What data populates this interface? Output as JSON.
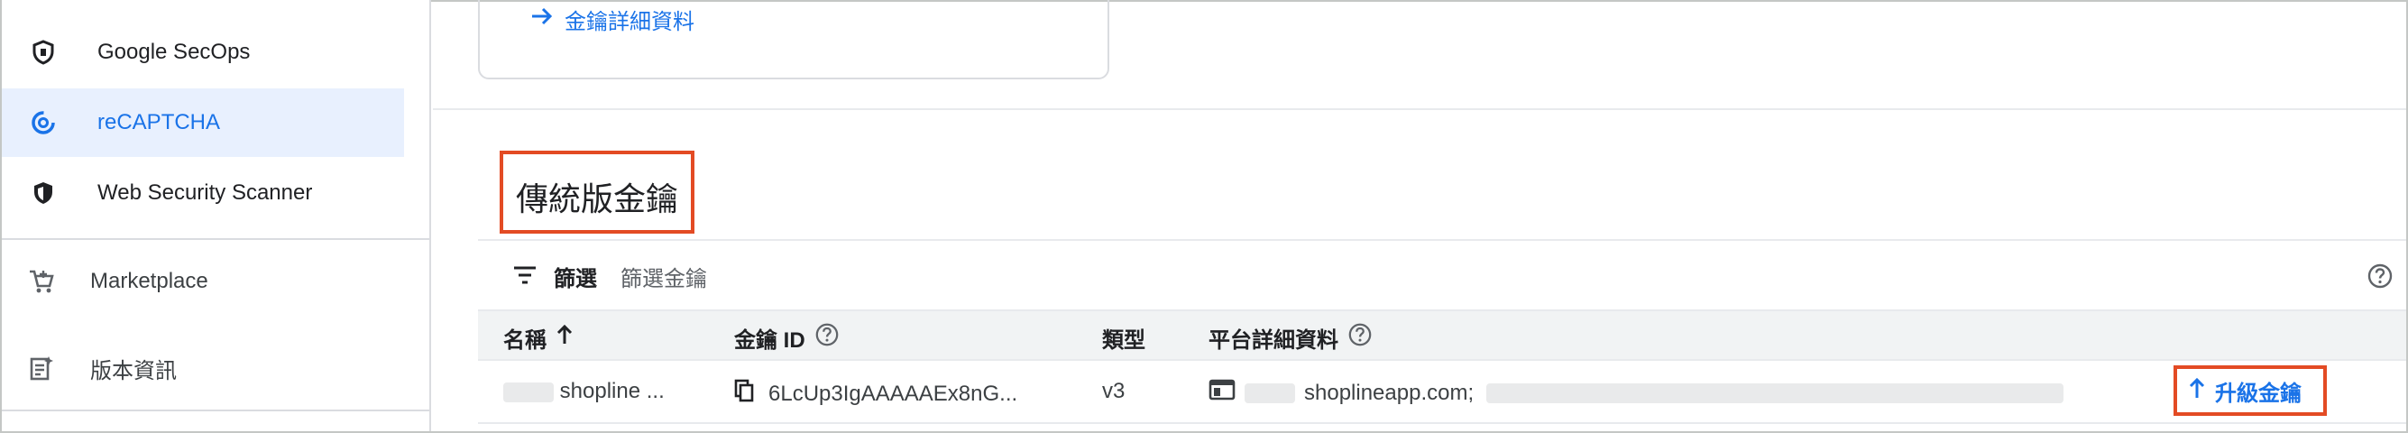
{
  "sidebar": {
    "items": [
      {
        "label": "Google SecOps",
        "icon": "shield-outline-icon"
      },
      {
        "label": "reCAPTCHA",
        "icon": "recaptcha-icon",
        "active": true
      },
      {
        "label": "Web Security Scanner",
        "icon": "shield-filled-icon"
      }
    ],
    "bottom_items": [
      {
        "label": "Marketplace",
        "icon": "cart-icon"
      },
      {
        "label": "版本資訊",
        "icon": "release-notes-icon"
      }
    ]
  },
  "card": {
    "detail_link": "金鑰詳細資料",
    "link_icon": "arrow-right-icon"
  },
  "section": {
    "title": "傳統版金鑰"
  },
  "filter": {
    "label": "篩選",
    "placeholder": "篩選金鑰",
    "icon": "filter-icon",
    "help_icon": "help-icon"
  },
  "table": {
    "headers": {
      "name": "名稱",
      "key_id": "金鑰 ID",
      "type": "類型",
      "platform": "平台詳細資料"
    },
    "rows": [
      {
        "name": "shopline ...",
        "key_id": "6LcUp3IgAAAAAEx8nG...",
        "type": "v3",
        "platform": "shoplineapp.com;"
      }
    ],
    "action": {
      "label": "升級金鑰",
      "icon": "arrow-up-icon"
    }
  },
  "colors": {
    "accent": "#1a73e8",
    "highlight": "#e34b24",
    "active_bg": "#e8f0fe"
  }
}
